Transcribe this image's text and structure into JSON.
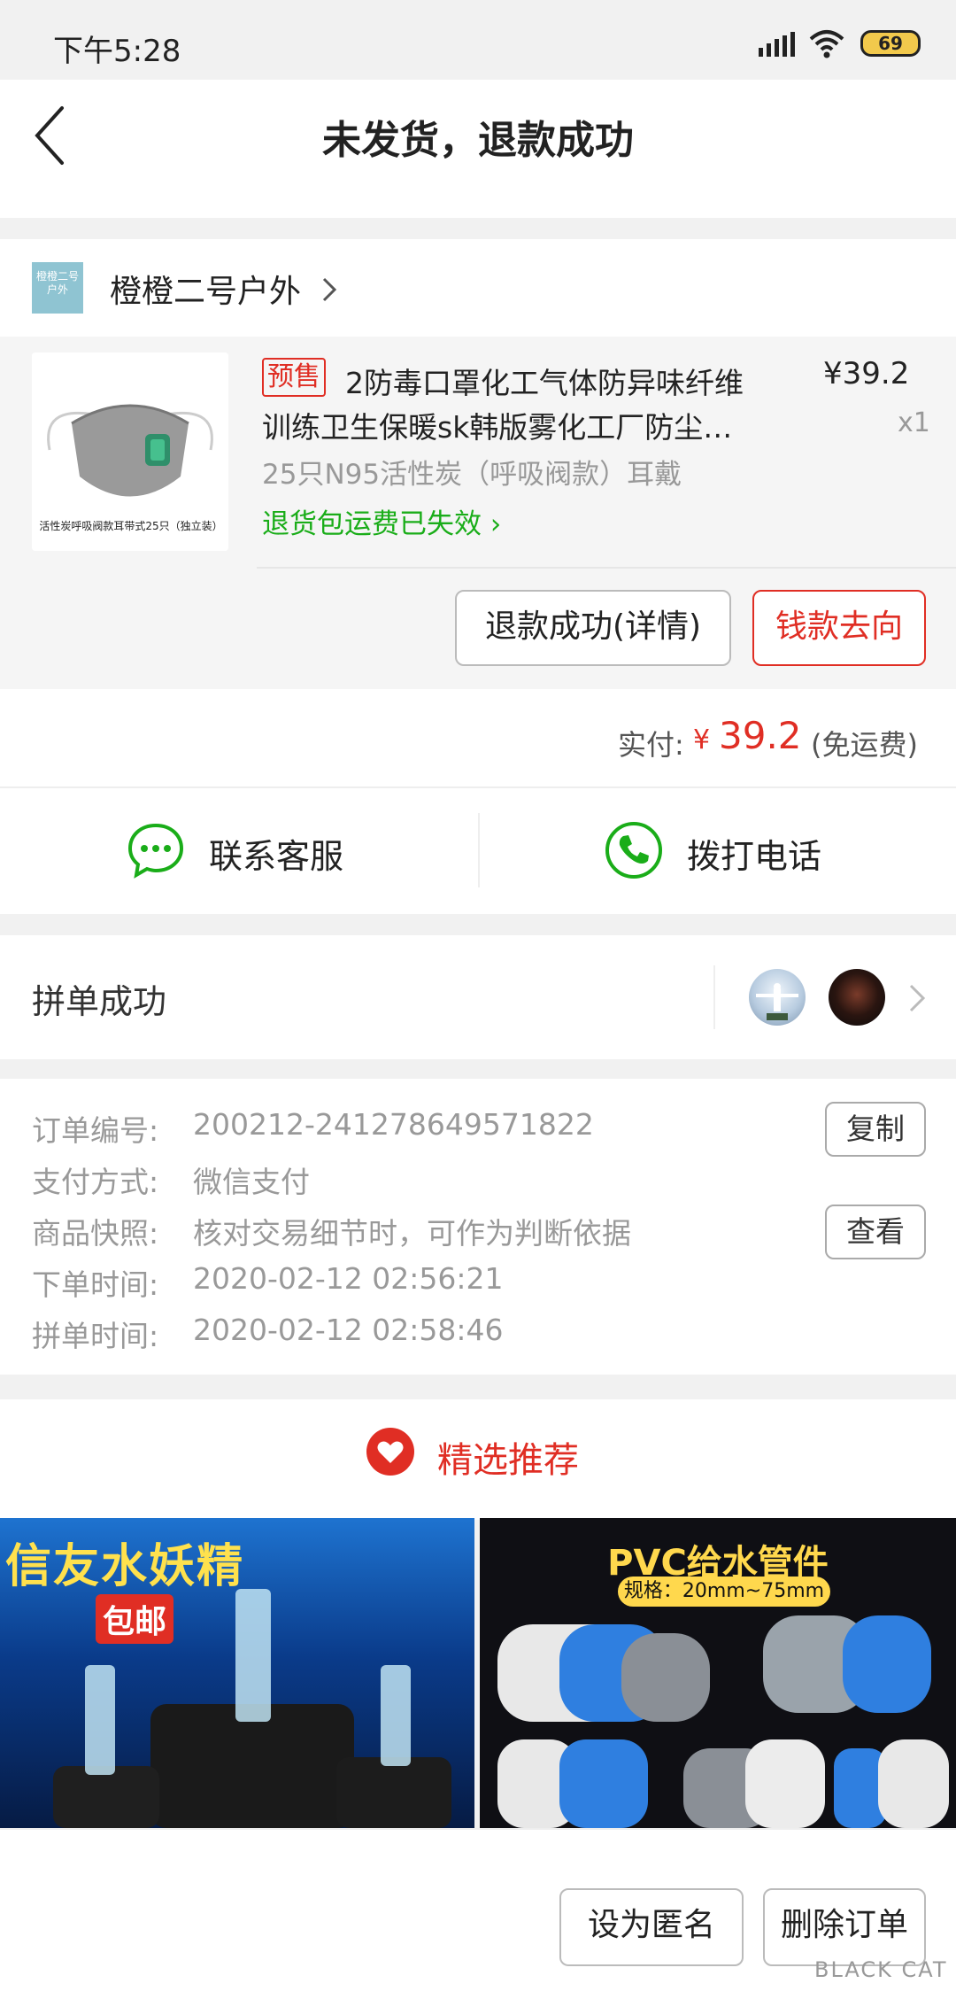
{
  "status_bar": {
    "time": "下午5:28",
    "battery": "69"
  },
  "nav": {
    "title": "未发货，退款成功"
  },
  "shop": {
    "logo_text_line1": "橙橙二号",
    "logo_text_line2": "户外",
    "name": "橙橙二号户外"
  },
  "product": {
    "image_caption": "活性炭呼吸阀款耳带式25只（独立装）",
    "presale_tag": "预售",
    "title_line1": "2防毒口罩化工气体防异味纤维",
    "title_line2": "训练卫生保暖sk韩版雾化工厂防尘…",
    "price": "¥39.2",
    "quantity": "x1",
    "spec": "25只N95活性炭（呼吸阀款）耳戴",
    "shipping_insurance": "退货包运费已失效"
  },
  "actions": {
    "refund_detail": "退款成功(详情)",
    "money_flow": "钱款去向"
  },
  "total": {
    "label": "实付:",
    "currency": "¥",
    "amount": "39.2",
    "note": "(免运费)"
  },
  "contact": {
    "service": "联系客服",
    "phone": "拨打电话"
  },
  "group": {
    "status": "拼单成功"
  },
  "order_info": {
    "rows": [
      {
        "label": "订单编号:",
        "value": "200212-241278649571822"
      },
      {
        "label": "支付方式:",
        "value": "微信支付"
      },
      {
        "label": "商品快照:",
        "value": "核对交易细节时，可作为判断依据"
      },
      {
        "label": "下单时间:",
        "value": "2020-02-12 02:56:21"
      },
      {
        "label": "拼单时间:",
        "value": "2020-02-12 02:58:46"
      }
    ],
    "copy_button": "复制",
    "view_button": "查看"
  },
  "recommend": {
    "title": "精选推荐"
  },
  "tiles": {
    "left_title": "信友水妖精",
    "left_badge": "包邮",
    "right_title": "PVC给水管件",
    "right_sub": "规格：20mm~75mm"
  },
  "bottom": {
    "anonymous": "设为匿名",
    "delete": "删除订单",
    "watermark": "BLACK CAT"
  },
  "colors": {
    "accent_red": "#e02e24",
    "green": "#1aad19",
    "icons": [
      "back-arrow-icon",
      "chevron-right-icon",
      "chat-bubble-icon",
      "phone-icon",
      "heart-icon",
      "wifi-icon",
      "signal-icon",
      "battery-icon"
    ]
  }
}
